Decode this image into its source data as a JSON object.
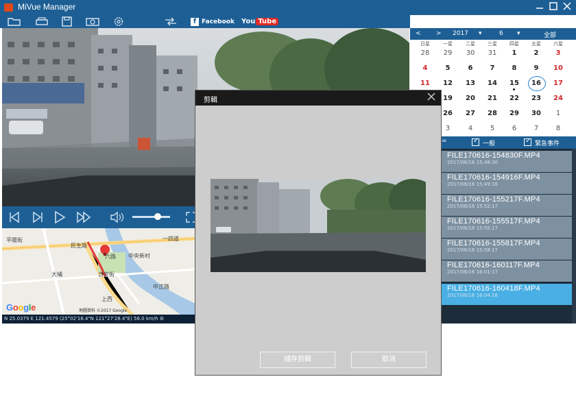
{
  "window": {
    "title": "MiVue Manager"
  },
  "toolbar": {
    "facebook_label": "Facebook",
    "youtube_you": "You",
    "youtube_tube": "Tube"
  },
  "map": {
    "labels": [
      "一四道",
      "民生路",
      "中央新村",
      "六路",
      "大埔",
      "平陽街",
      "吉安街",
      "上西",
      "中正路"
    ],
    "google_letters": [
      "G",
      "o",
      "o",
      "g",
      "l",
      "e"
    ],
    "google_colors": [
      "#4285f4",
      "#ea4335",
      "#fbbc05",
      "#4285f4",
      "#34a853",
      "#ea4335"
    ],
    "copyright": "地圖資料 ©2017 Google"
  },
  "status": {
    "text": "N 25.0379 E 121.4579 (25°02'16.4\"N 121°27'28.4\"E)  56.0 km/h  ⚙"
  },
  "calendar": {
    "year": "2017",
    "month": "6",
    "all_label": "全部",
    "weekdays": [
      "日星",
      "一星",
      "二星",
      "三星",
      "四星",
      "五星",
      "六星"
    ],
    "weeks": [
      [
        "28",
        "29",
        "30",
        "31",
        "1",
        "2",
        "3"
      ],
      [
        "4",
        "5",
        "6",
        "7",
        "8",
        "9",
        "10"
      ],
      [
        "11",
        "12",
        "13",
        "14",
        "15",
        "16",
        "17"
      ],
      [
        "18",
        "19",
        "20",
        "21",
        "22",
        "23",
        "24"
      ],
      [
        "25",
        "26",
        "27",
        "28",
        "29",
        "30",
        "1"
      ],
      [
        "2",
        "3",
        "4",
        "5",
        "6",
        "7",
        "8"
      ]
    ]
  },
  "filter": {
    "opt1": "一般",
    "opt2": "緊急事件"
  },
  "files": [
    {
      "name": "FILE170616-154830F.MP4",
      "date": "2017/06/16 15:48:30"
    },
    {
      "name": "FILE170616-154916F.MP4",
      "date": "2017/06/16 15:49:16"
    },
    {
      "name": "FILE170616-155217F.MP4",
      "date": "2017/06/16 15:52:17"
    },
    {
      "name": "FILE170616-155517F.MP4",
      "date": "2017/06/16 15:55:17"
    },
    {
      "name": "FILE170616-155817F.MP4",
      "date": "2017/06/16 15:58:17"
    },
    {
      "name": "FILE170616-160117F.MP4",
      "date": "2017/06/16 16:01:17"
    },
    {
      "name": "FILE170616-160418F.MP4",
      "date": "2017/06/16 16:04:18"
    }
  ],
  "dialog": {
    "title": "剪輯",
    "save_label": "儲存剪輯",
    "cancel_label": "取消"
  }
}
